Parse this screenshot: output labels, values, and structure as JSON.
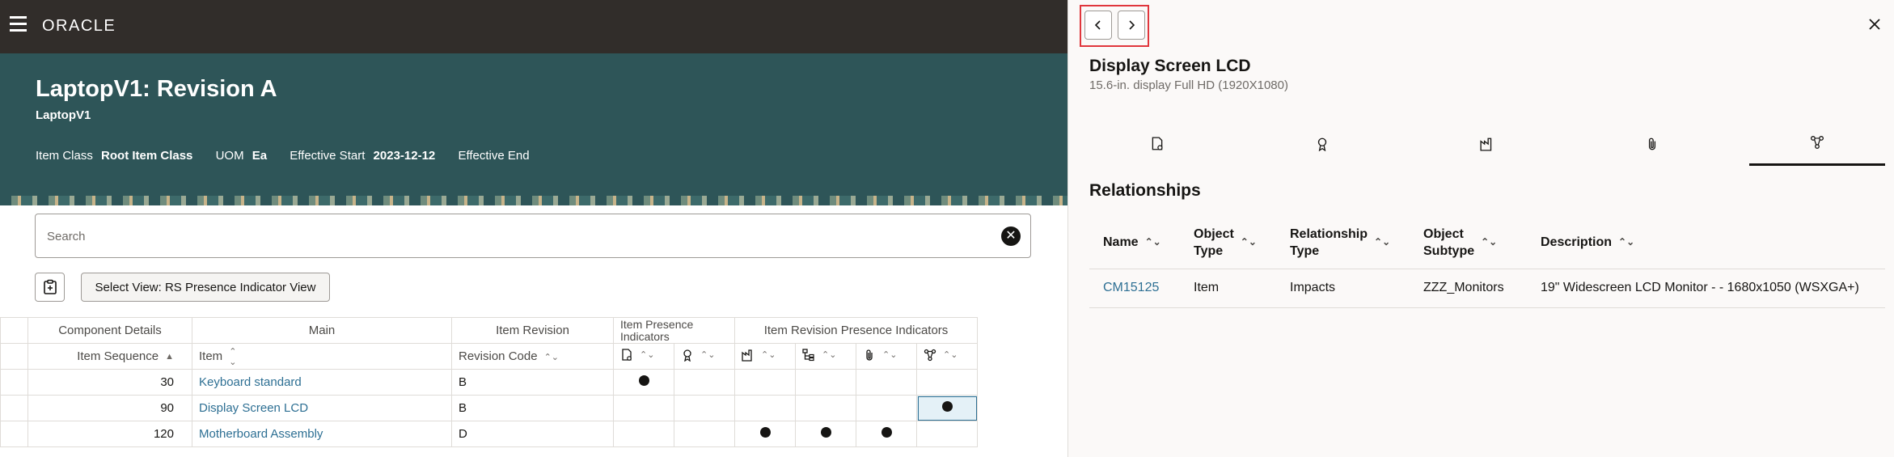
{
  "app": {
    "logo": "ORACLE"
  },
  "banner": {
    "title": "LaptopV1: Revision A",
    "subtitle": "LaptopV1",
    "item_class_label": "Item Class",
    "item_class_value": "Root Item Class",
    "uom_label": "UOM",
    "uom_value": "Ea",
    "eff_start_label": "Effective Start",
    "eff_start_value": "2023-12-12",
    "eff_end_label": "Effective End"
  },
  "search": {
    "placeholder": "Search"
  },
  "toolbar": {
    "view_label": "Select View: RS Presence Indicator View"
  },
  "grid": {
    "groups": {
      "component": "Component Details",
      "main": "Main",
      "item_revision": "Item Revision",
      "item_presence": "Item Presence Indicators",
      "rev_presence": "Item Revision Presence Indicators"
    },
    "columns": {
      "item_sequence": "Item Sequence",
      "item": "Item",
      "revision_code": "Revision Code"
    },
    "rows": [
      {
        "seq": "30",
        "item": "Keyboard standard",
        "rev": "B",
        "ind": [
          true,
          false,
          false,
          false,
          false,
          false
        ]
      },
      {
        "seq": "90",
        "item": "Display Screen LCD",
        "rev": "B",
        "ind": [
          false,
          false,
          false,
          false,
          false,
          true
        ]
      },
      {
        "seq": "120",
        "item": "Motherboard Assembly",
        "rev": "D",
        "ind": [
          false,
          false,
          true,
          true,
          true,
          false
        ]
      }
    ]
  },
  "drawer": {
    "title": "Display Screen LCD",
    "subtitle": "15.6-in. display Full HD (1920X1080)",
    "section_title": "Relationships",
    "columns": [
      "Name",
      "Object Type",
      "Relationship Type",
      "Object Subtype",
      "Description"
    ],
    "columns_split": [
      [
        "Name",
        ""
      ],
      [
        "Object",
        "Type"
      ],
      [
        "Relationship",
        "Type"
      ],
      [
        "Object",
        "Subtype"
      ],
      [
        "Description",
        ""
      ]
    ],
    "rows": [
      {
        "name": "CM15125",
        "object_type": "Item",
        "relationship_type": "Impacts",
        "object_subtype": "ZZZ_Monitors",
        "description": "19\" Widescreen LCD Monitor - - 1680x1050 (WSXGA+)"
      }
    ]
  },
  "colors": {
    "accent": "#2d6f93",
    "banner": "#2e5558",
    "topbar": "#312d2a",
    "highlight": "#e0363c"
  }
}
